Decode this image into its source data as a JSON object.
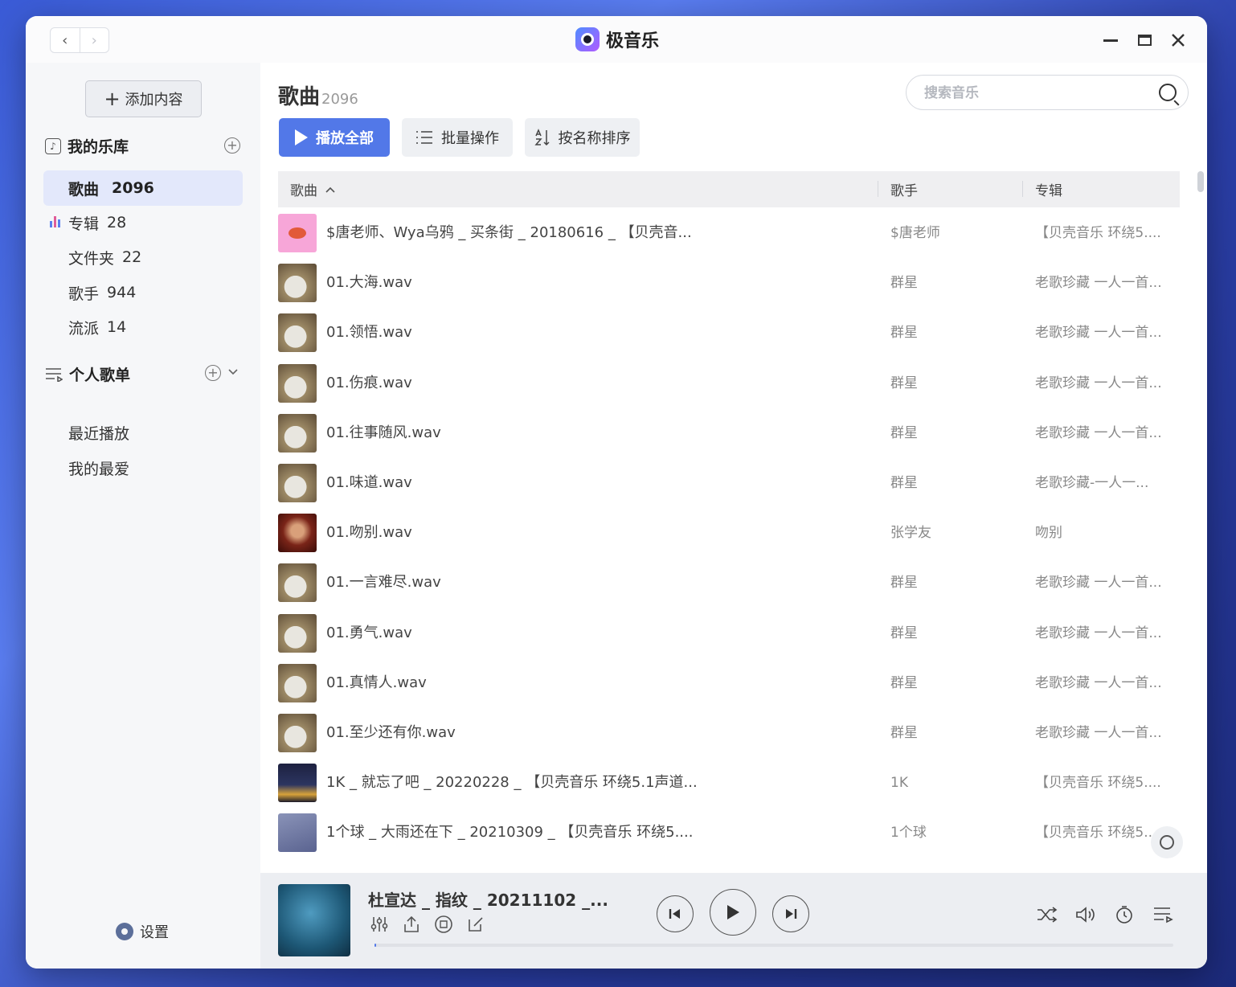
{
  "app": {
    "title": "极音乐",
    "nav_back": "‹",
    "nav_forward": "›"
  },
  "sidebar": {
    "add_label": "添加内容",
    "library_title": "我的乐库",
    "library_items": [
      {
        "label": "歌曲",
        "count": "2096"
      },
      {
        "label": "专辑",
        "count": "28"
      },
      {
        "label": "文件夹",
        "count": "22"
      },
      {
        "label": "歌手",
        "count": "944"
      },
      {
        "label": "流派",
        "count": "14"
      }
    ],
    "playlist_title": "个人歌单",
    "playlist_items": [
      "最近播放",
      "我的最爱"
    ],
    "settings_label": "设置"
  },
  "main": {
    "title": "歌曲",
    "count": "2096",
    "search_placeholder": "搜索音乐",
    "toolbar": {
      "play_all": "播放全部",
      "batch": "批量操作",
      "sort": "按名称排序"
    },
    "columns": {
      "title": "歌曲",
      "artist": "歌手",
      "album": "专辑"
    },
    "rows": [
      {
        "title": "$唐老师、Wya乌鸦 _ 买条街 _ 20180616 _ 【贝壳音...",
        "artist": "$唐老师",
        "album": "【贝壳音乐 环绕5...."
      },
      {
        "title": "01.大海.wav",
        "artist": "群星",
        "album": "老歌珍藏 一人一首..."
      },
      {
        "title": "01.领悟.wav",
        "artist": "群星",
        "album": "老歌珍藏 一人一首..."
      },
      {
        "title": "01.伤痕.wav",
        "artist": "群星",
        "album": "老歌珍藏 一人一首..."
      },
      {
        "title": "01.往事随风.wav",
        "artist": "群星",
        "album": "老歌珍藏 一人一首..."
      },
      {
        "title": "01.味道.wav",
        "artist": "群星",
        "album": "老歌珍藏-一人一..."
      },
      {
        "title": "01.吻别.wav",
        "artist": "张学友",
        "album": "吻别"
      },
      {
        "title": "01.一言难尽.wav",
        "artist": "群星",
        "album": "老歌珍藏 一人一首..."
      },
      {
        "title": "01.勇气.wav",
        "artist": "群星",
        "album": "老歌珍藏 一人一首..."
      },
      {
        "title": "01.真情人.wav",
        "artist": "群星",
        "album": "老歌珍藏 一人一首..."
      },
      {
        "title": "01.至少还有你.wav",
        "artist": "群星",
        "album": "老歌珍藏 一人一首..."
      },
      {
        "title": "1K _ 就忘了吧 _ 20220228 _ 【贝壳音乐 环绕5.1声道...",
        "artist": "1K",
        "album": "【贝壳音乐 环绕5...."
      },
      {
        "title": "1个球 _ 大雨还在下 _ 20210309 _ 【贝壳音乐 环绕5....",
        "artist": "1个球",
        "album": "【贝壳音乐 环绕5...."
      }
    ]
  },
  "player": {
    "now_playing": "杜宣达 _ 指纹 _ 20211102 _...",
    "progress": 0.002
  },
  "colors": {
    "accent": "#5278e8",
    "active_bg": "#e3e8fb"
  }
}
